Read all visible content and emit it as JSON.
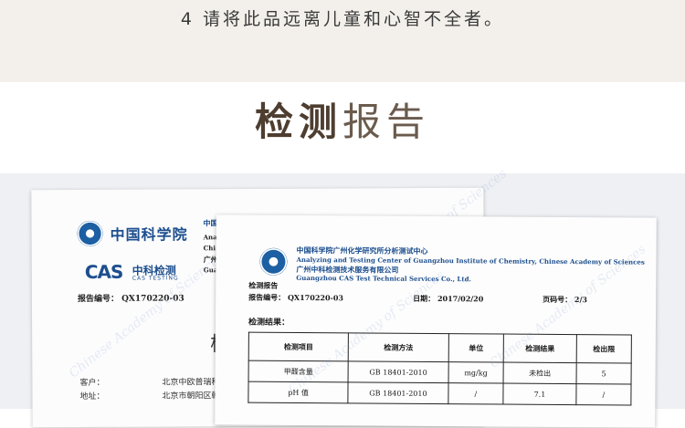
{
  "notice": "4 请将此品远离儿童和心智不全者。",
  "section_title": {
    "light_part": "检测",
    "full": "检测报告"
  },
  "back_doc": {
    "org_name": "中国科学院",
    "logo_main": "CAS",
    "logo_cn": "中科检测",
    "logo_en": "CAS TESTING",
    "report_no": "报告编号： QX170220-03",
    "big_char": "检",
    "rows": [
      {
        "label": "客户：",
        "value": "北京中欧普瑞科"
      },
      {
        "label": "地址：",
        "value": "北京市朝阳区朝"
      }
    ],
    "side_chars": [
      "中国",
      "Ana",
      "Chi",
      "广州",
      "Guar"
    ]
  },
  "front_doc": {
    "inst_cn": "中国科学院广州化学研究所分析测试中心",
    "inst_en": "Analyzing and Testing Center of Guangzhou Institute of Chemistry, Chinese Academy of Sciences",
    "lab_cn": "广州中科检测技术服务有限公司",
    "lab_en": "Guangzhou CAS Test Technical Services Co., Ltd.",
    "doc_label": "检测报告",
    "report_no": "报告编号：  QX170220-03",
    "date": "日期：  2017/02/20",
    "page": "页码号：  2/3",
    "results_label": "检测结果：",
    "table": {
      "headers": [
        "检测项目",
        "检测方法",
        "单位",
        "检测结果",
        "检出限"
      ],
      "rows": [
        [
          "甲醛含量",
          "GB 18401-2010",
          "mg/kg",
          "未检出",
          "5"
        ],
        [
          "pH 值",
          "GB 18401-2010",
          "/",
          "7.1",
          "/"
        ]
      ]
    }
  },
  "watermark_text": "Chinese Academy of Sciences"
}
